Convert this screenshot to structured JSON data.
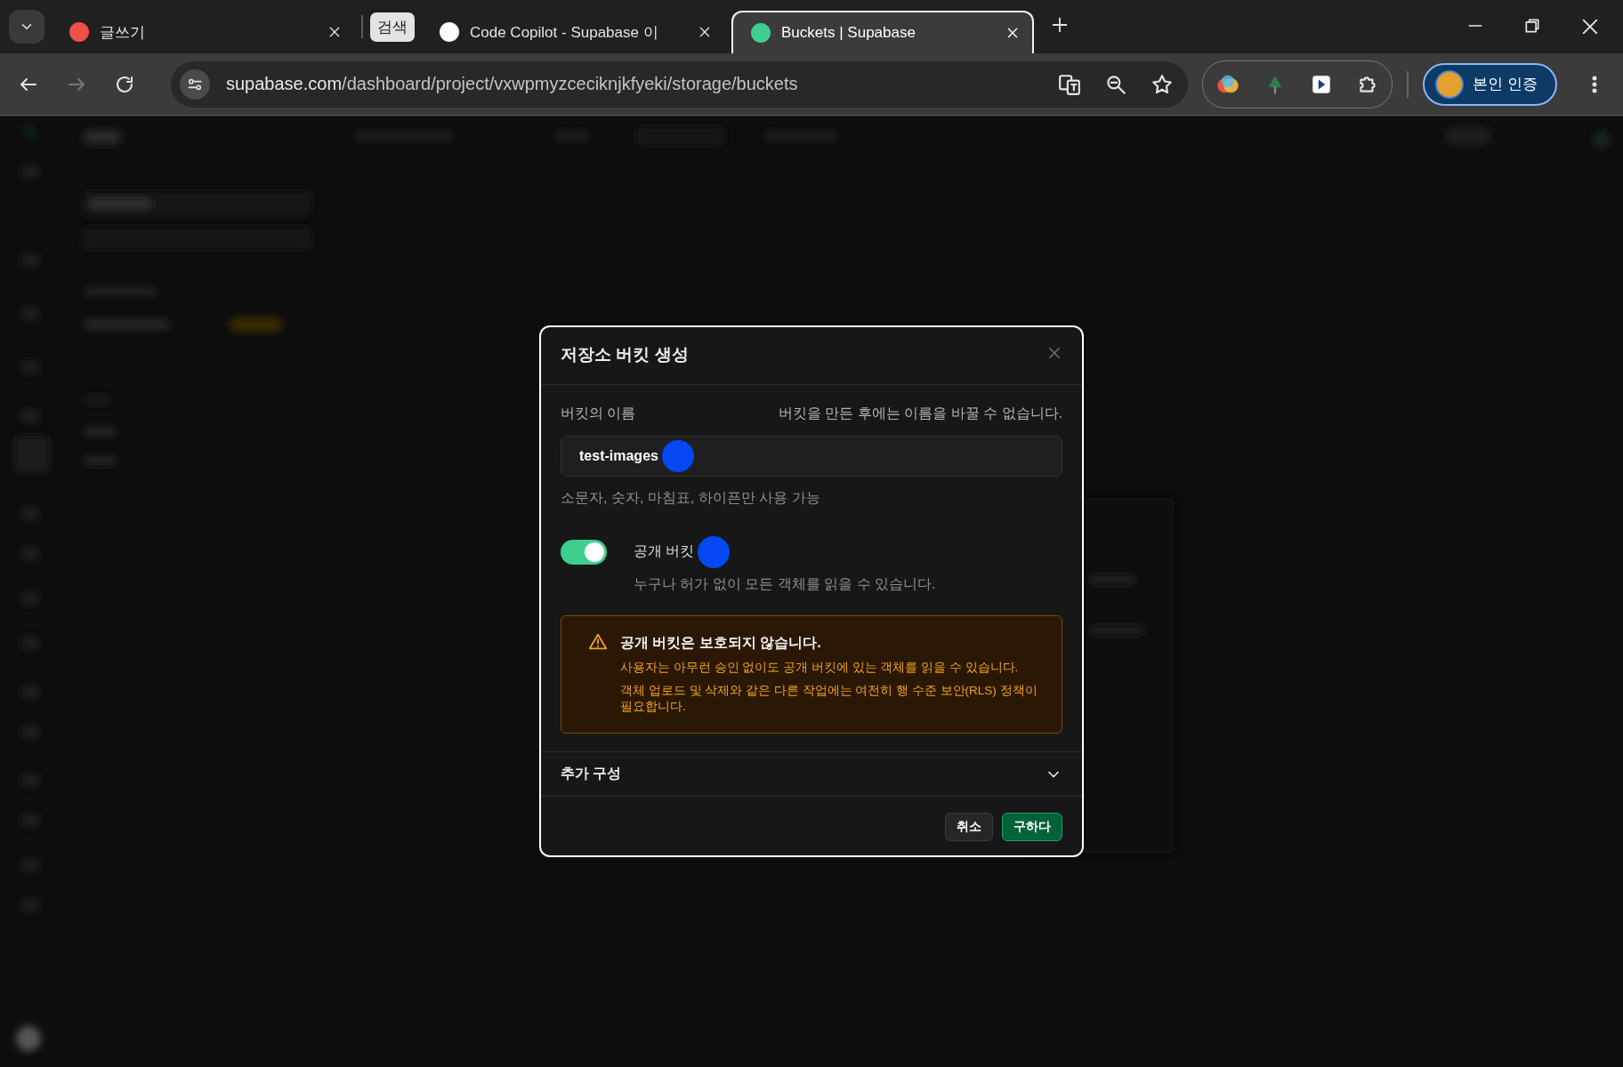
{
  "browser": {
    "tabs": [
      {
        "kind": "tab",
        "title": "글쓰기",
        "color": "#f0504a",
        "selected": false
      },
      {
        "kind": "group",
        "title": "검색"
      },
      {
        "kind": "tab",
        "title": "Code Copilot - Supabase 이",
        "color": "#ffffff",
        "selected": false
      },
      {
        "kind": "tab",
        "title": "Buckets | Supabase",
        "color": "#3ecf8e",
        "selected": true
      }
    ],
    "url_host": "supabase.com",
    "url_path": "/dashboard/project/vxwpmyzceciknjkfyeki/storage/buckets",
    "profile": "본인 인증"
  },
  "dialog": {
    "title": "저장소 버킷 생성",
    "name_field": {
      "label": "버킷의 이름",
      "note": "버킷을 만든 후에는 이름을 바꿀 수 없습니다.",
      "value": "test-images",
      "help": "소문자, 숫자, 마침표, 하이픈만 사용 가능"
    },
    "public_toggle": {
      "on": true,
      "label": "공개 버킷",
      "description": "누구나 허가 없이 모든 객체를 읽을 수 있습니다."
    },
    "warning": {
      "title": "공개 버킷은 보호되지 않습니다.",
      "lines": [
        "사용자는 아무런 승인 없이도 공개 버킷에 있는 객체를 읽을 수 있습니다.",
        "객체 업로드 및 삭제와 같은 다른 작업에는 여전히 행 수준 보안(RLS) 정책이 필요합니다."
      ]
    },
    "advanced": {
      "label": "추가 구성",
      "expanded": false
    },
    "buttons": [
      {
        "kind": "secondary",
        "label": "취소"
      },
      {
        "kind": "primary",
        "label": "구하다"
      }
    ]
  }
}
